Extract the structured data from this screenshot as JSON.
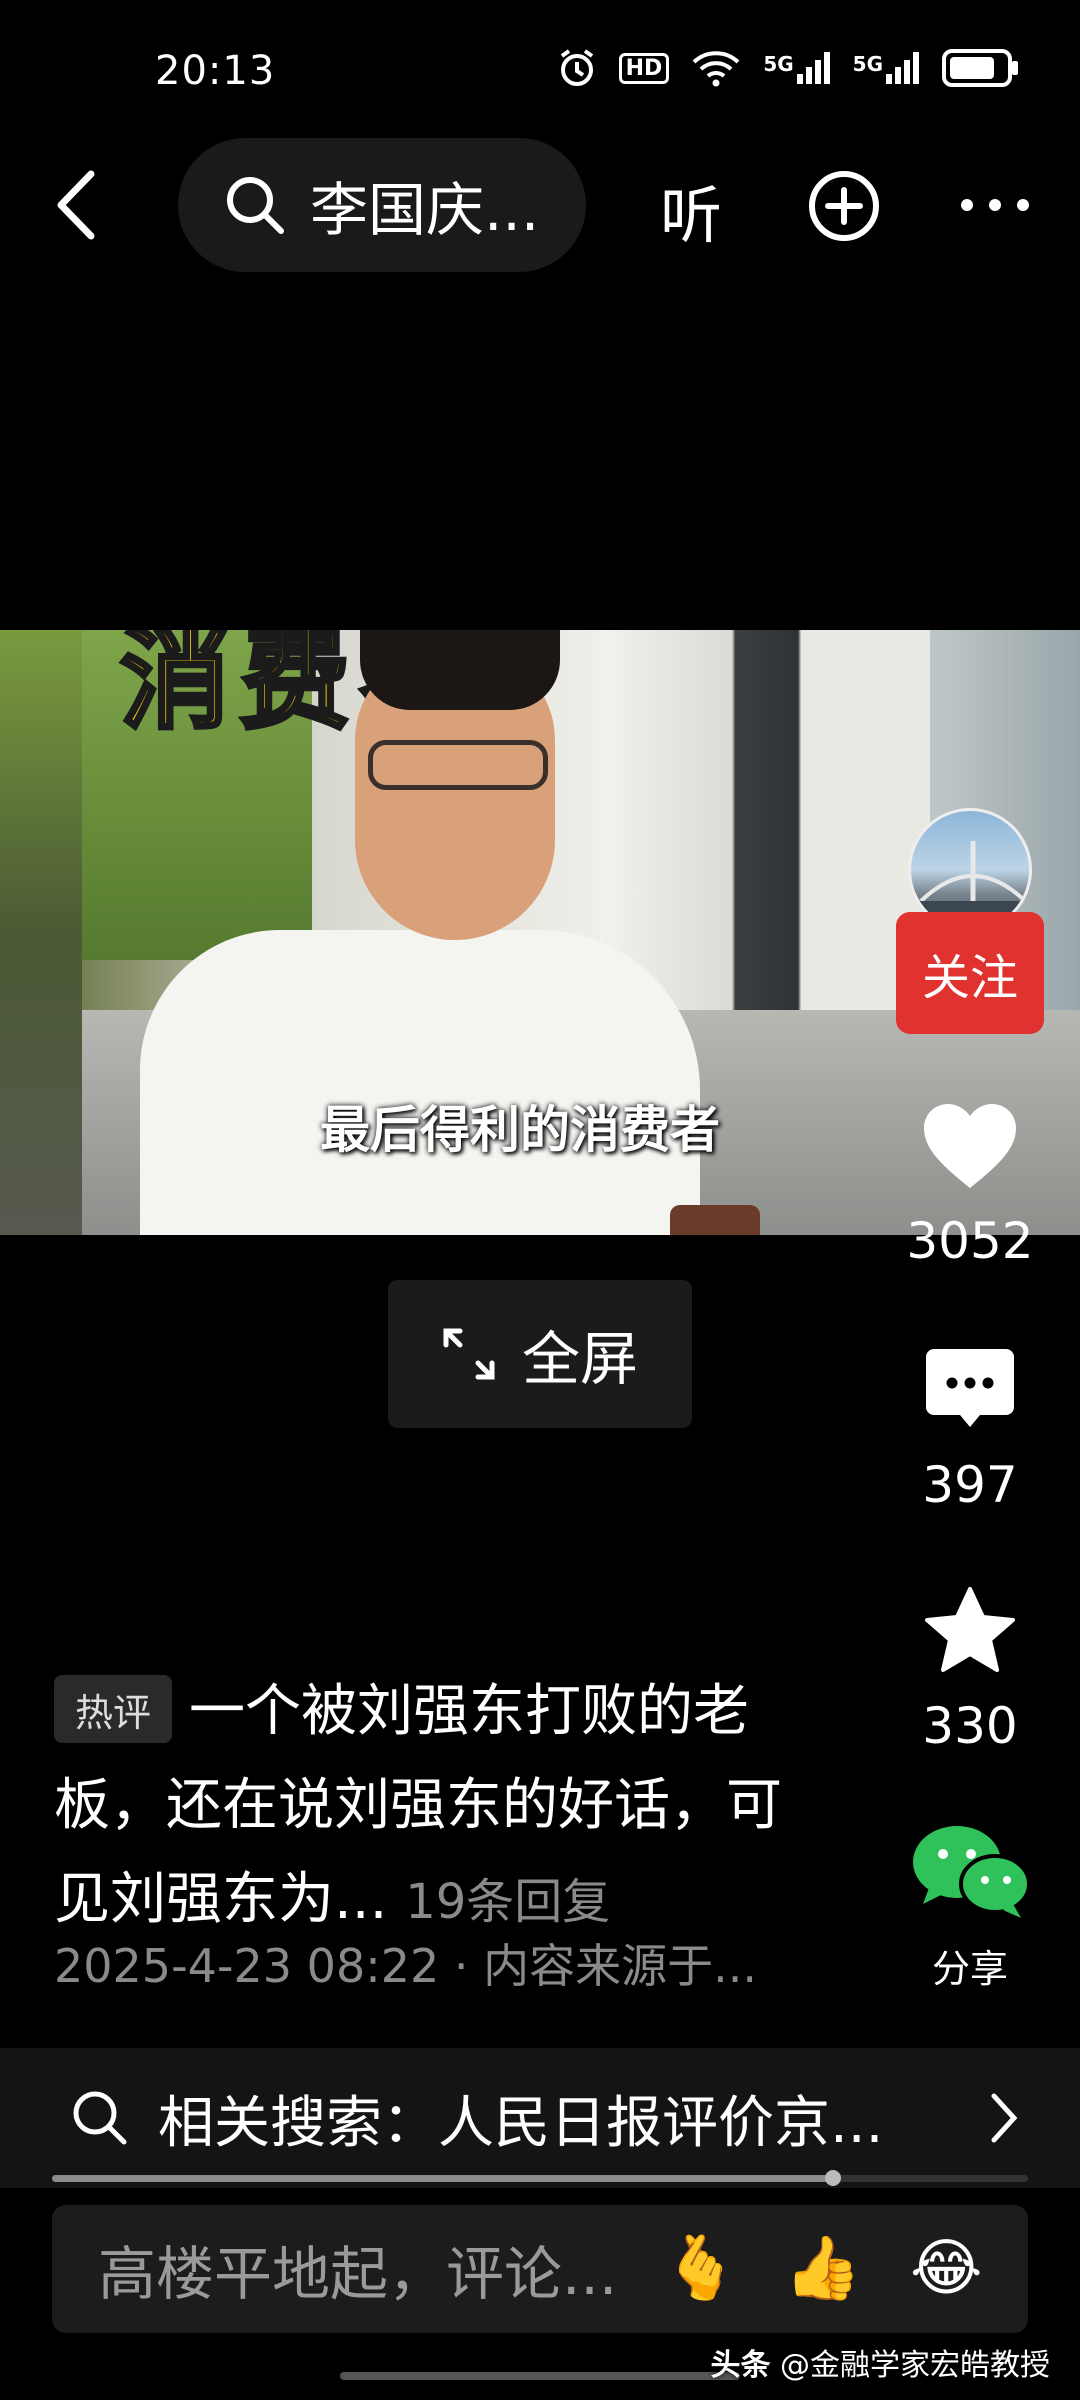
{
  "status_bar": {
    "time": "20:13",
    "icons": [
      "alarm-icon",
      "hd-icon",
      "wifi-icon",
      "5g-signal-icon",
      "5g-signal-icon",
      "battery-icon"
    ],
    "hd_label": "HD",
    "net1": "5G",
    "net2": "5G"
  },
  "top_nav": {
    "search_label": "李国庆...",
    "listen_label": "听"
  },
  "video": {
    "top_caption": "消费者",
    "subtitle": "最后得利的消费者"
  },
  "side_rail": {
    "follow_label": "关注",
    "like_count": "3052",
    "comment_count": "397",
    "favorite_count": "330",
    "share_label": "分享"
  },
  "fullscreen": {
    "label": "全屏"
  },
  "hot_comment": {
    "tag": "热评",
    "text": "一个被刘强东打败的老板，还在说刘强东的好话，可见刘强东为...",
    "replies": "19条回复",
    "meta": "2025-4-23 08:22 · 内容来源于..."
  },
  "related_search": {
    "label": "相关搜索：人民日报评价京..."
  },
  "progress": {
    "fraction": 0.8
  },
  "comment_bar": {
    "placeholder": "高楼平地起，评论...",
    "emojis": [
      "🫰",
      "👍",
      "😂"
    ]
  },
  "watermark": {
    "brand": "头条",
    "account": "@金融学家宏皓教授"
  },
  "colors": {
    "background": "#000000",
    "follow_red": "#e0322f",
    "wechat_green": "#2fc25b",
    "muted_text": "#8a8a8a"
  }
}
